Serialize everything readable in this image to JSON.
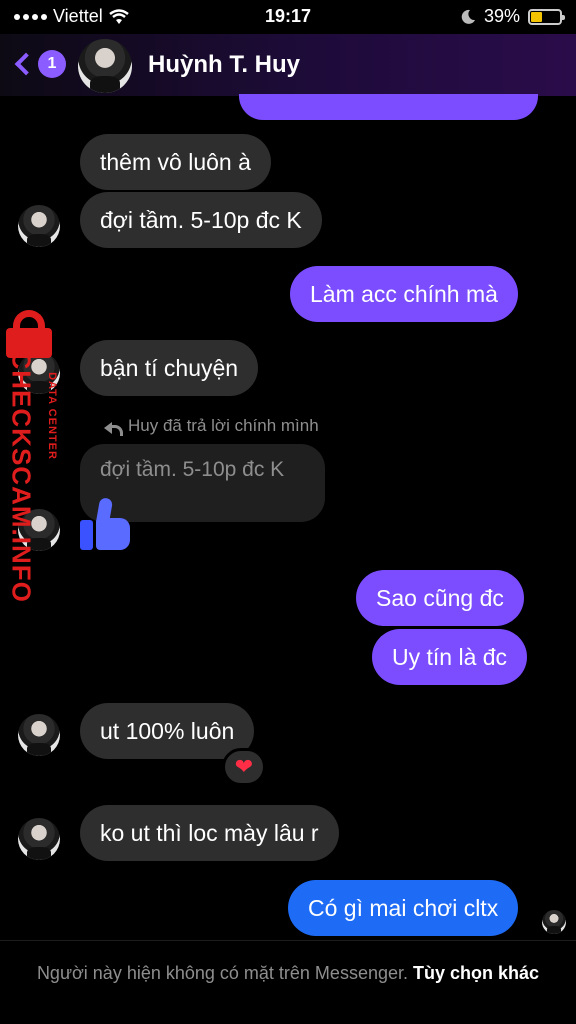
{
  "status_bar": {
    "carrier": "Viettel",
    "time": "19:17",
    "battery": "39%",
    "battery_level": 0.39,
    "icons": [
      "signal-dots-icon",
      "wifi-icon",
      "moon-icon",
      "battery-icon"
    ]
  },
  "header": {
    "back_count": "1",
    "name": "Huỳnh T. Huy"
  },
  "messages": {
    "m1": "thêm vô luôn à",
    "m2": "đợi tầm. 5-10p đc K",
    "m3": "Làm acc chính mà",
    "m4": "bận tí chuyện",
    "reply_note": "Huy đã trả lời chính mình",
    "quoted": "đợi tầm. 5-10p đc K",
    "m5": "Sao cũng đc",
    "m6": "Uy tín là đc",
    "m7": "ut 100% luôn",
    "m7_reaction": "❤",
    "m8": "ko ut thì loc mày lâu r",
    "m9": "Có gì mai chơi cltx"
  },
  "watermark": {
    "main": "CHECKSCAM.INFO",
    "sub": "DATA CENTER"
  },
  "footer": {
    "note": "Người này hiện không có mặt trên Messenger.",
    "action": "Tùy chọn khác"
  },
  "colors": {
    "outgoing": "#7b4dff",
    "outgoing_last": "#1e6cf5",
    "incoming": "#2e2e2e",
    "accent": "#8b5cff",
    "watermark": "#e01d1d"
  }
}
